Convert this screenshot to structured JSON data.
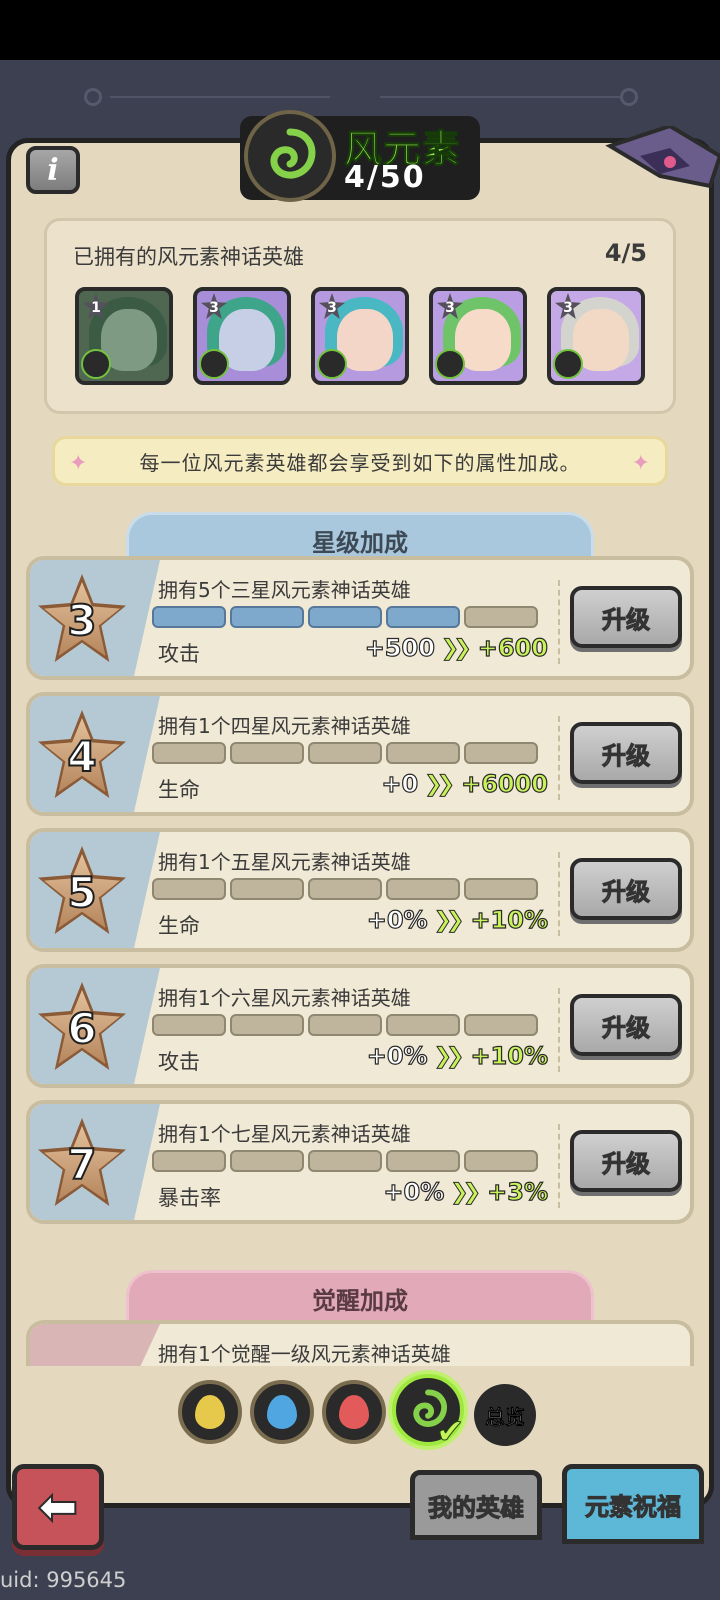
{
  "header": {
    "title": "风元素",
    "count": "4/50",
    "info_label": "i"
  },
  "owned": {
    "label": "已拥有的风元素神话英雄",
    "count": "4/5",
    "heroes": [
      {
        "star": "1"
      },
      {
        "star": "3"
      },
      {
        "star": "3"
      },
      {
        "star": "3"
      },
      {
        "star": "3"
      }
    ]
  },
  "notice": "每一位风元素英雄都会享受到如下的属性加成。",
  "star_section": {
    "title": "星级加成",
    "rows": [
      {
        "star": "3",
        "requirement": "拥有5个三星风元素神话英雄",
        "stat": "攻击",
        "from": "+500",
        "to": "+600",
        "progress": 4,
        "segments": 5,
        "button": "升级"
      },
      {
        "star": "4",
        "requirement": "拥有1个四星风元素神话英雄",
        "stat": "生命",
        "from": "+0",
        "to": "+6000",
        "progress": 0,
        "segments": 5,
        "button": "升级"
      },
      {
        "star": "5",
        "requirement": "拥有1个五星风元素神话英雄",
        "stat": "生命",
        "from": "+0%",
        "to": "+10%",
        "progress": 0,
        "segments": 5,
        "button": "升级"
      },
      {
        "star": "6",
        "requirement": "拥有1个六星风元素神话英雄",
        "stat": "攻击",
        "from": "+0%",
        "to": "+10%",
        "progress": 0,
        "segments": 5,
        "button": "升级"
      },
      {
        "star": "7",
        "requirement": "拥有1个七星风元素神话英雄",
        "stat": "暴击率",
        "from": "+0%",
        "to": "+3%",
        "progress": 0,
        "segments": 5,
        "button": "升级"
      }
    ]
  },
  "awaken_section": {
    "title": "觉醒加成",
    "first_requirement": "拥有1个觉醒一级风元素神话英雄"
  },
  "element_selector": {
    "items": [
      {
        "name": "earth",
        "color": "#e6c84a"
      },
      {
        "name": "water",
        "color": "#4fa6e0"
      },
      {
        "name": "fire",
        "color": "#e25a5a"
      },
      {
        "name": "wind",
        "color": "#86d14a",
        "active": true
      }
    ],
    "overview_label": "总览"
  },
  "bottom": {
    "my_heroes": "我的英雄",
    "blessing": "元素祝福"
  },
  "uid": "uid: 995645",
  "colors": {
    "accent_green": "#9de05a",
    "progress_blue": "#7fa9cc",
    "bonus_green": "#c9f25a"
  }
}
